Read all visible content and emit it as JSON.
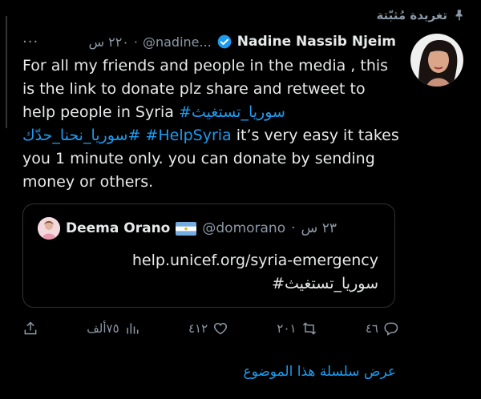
{
  "pinned": {
    "label": "تغريدة مُثبّتة",
    "icon": "pin-icon"
  },
  "tweet": {
    "author_name": "Nadine Nassib Njeim",
    "author_handle": "@nadine...",
    "time": "٢٢٠ س",
    "separator": "·",
    "more_label": "···",
    "body_parts": {
      "p1": "For all my friends and people in the media , this is the link to donate plz share and retweet to help people in Syria ",
      "h1": "#سوريا_تستغيث",
      "p2": " ",
      "h2": "#سوريا_نحنا_حدّك",
      "p3": "  ",
      "h3": "#HelpSyria",
      "p4": " it’s very easy it takes you 1 minute only. you can donate by sending money or others."
    }
  },
  "quote": {
    "author_name": "Deema Orano",
    "author_handle": "@domorano",
    "separator": "·",
    "time": "٢٣ س",
    "line1": "help.unicef.org/syria-emergency",
    "line2": "#سوريا_تستغيث"
  },
  "actions": {
    "views": "٧٥ألف",
    "likes": "٤١٢",
    "retweets": "٢٠١",
    "replies": "٤٦"
  },
  "show_thread": "عرض سلسلة هذا الموضوع",
  "colors": {
    "accent": "#1d9bf0",
    "muted": "#8b98a5",
    "background": "#000000"
  }
}
